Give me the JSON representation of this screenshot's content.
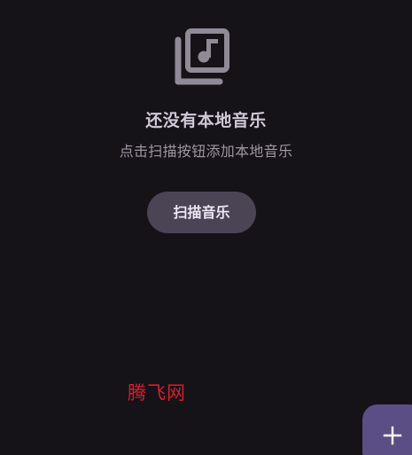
{
  "empty_state": {
    "icon": "music-library-icon",
    "title": "还没有本地音乐",
    "subtitle": "点击扫描按钮添加本地音乐",
    "scan_button_label": "扫描音乐"
  },
  "watermark": "腾飞网",
  "fab": {
    "icon": "plus-icon"
  },
  "colors": {
    "background": "#151218",
    "icon": "#8f8a95",
    "button": "#4a4455",
    "fab": "#5b4e85",
    "watermark": "#d6202a"
  }
}
